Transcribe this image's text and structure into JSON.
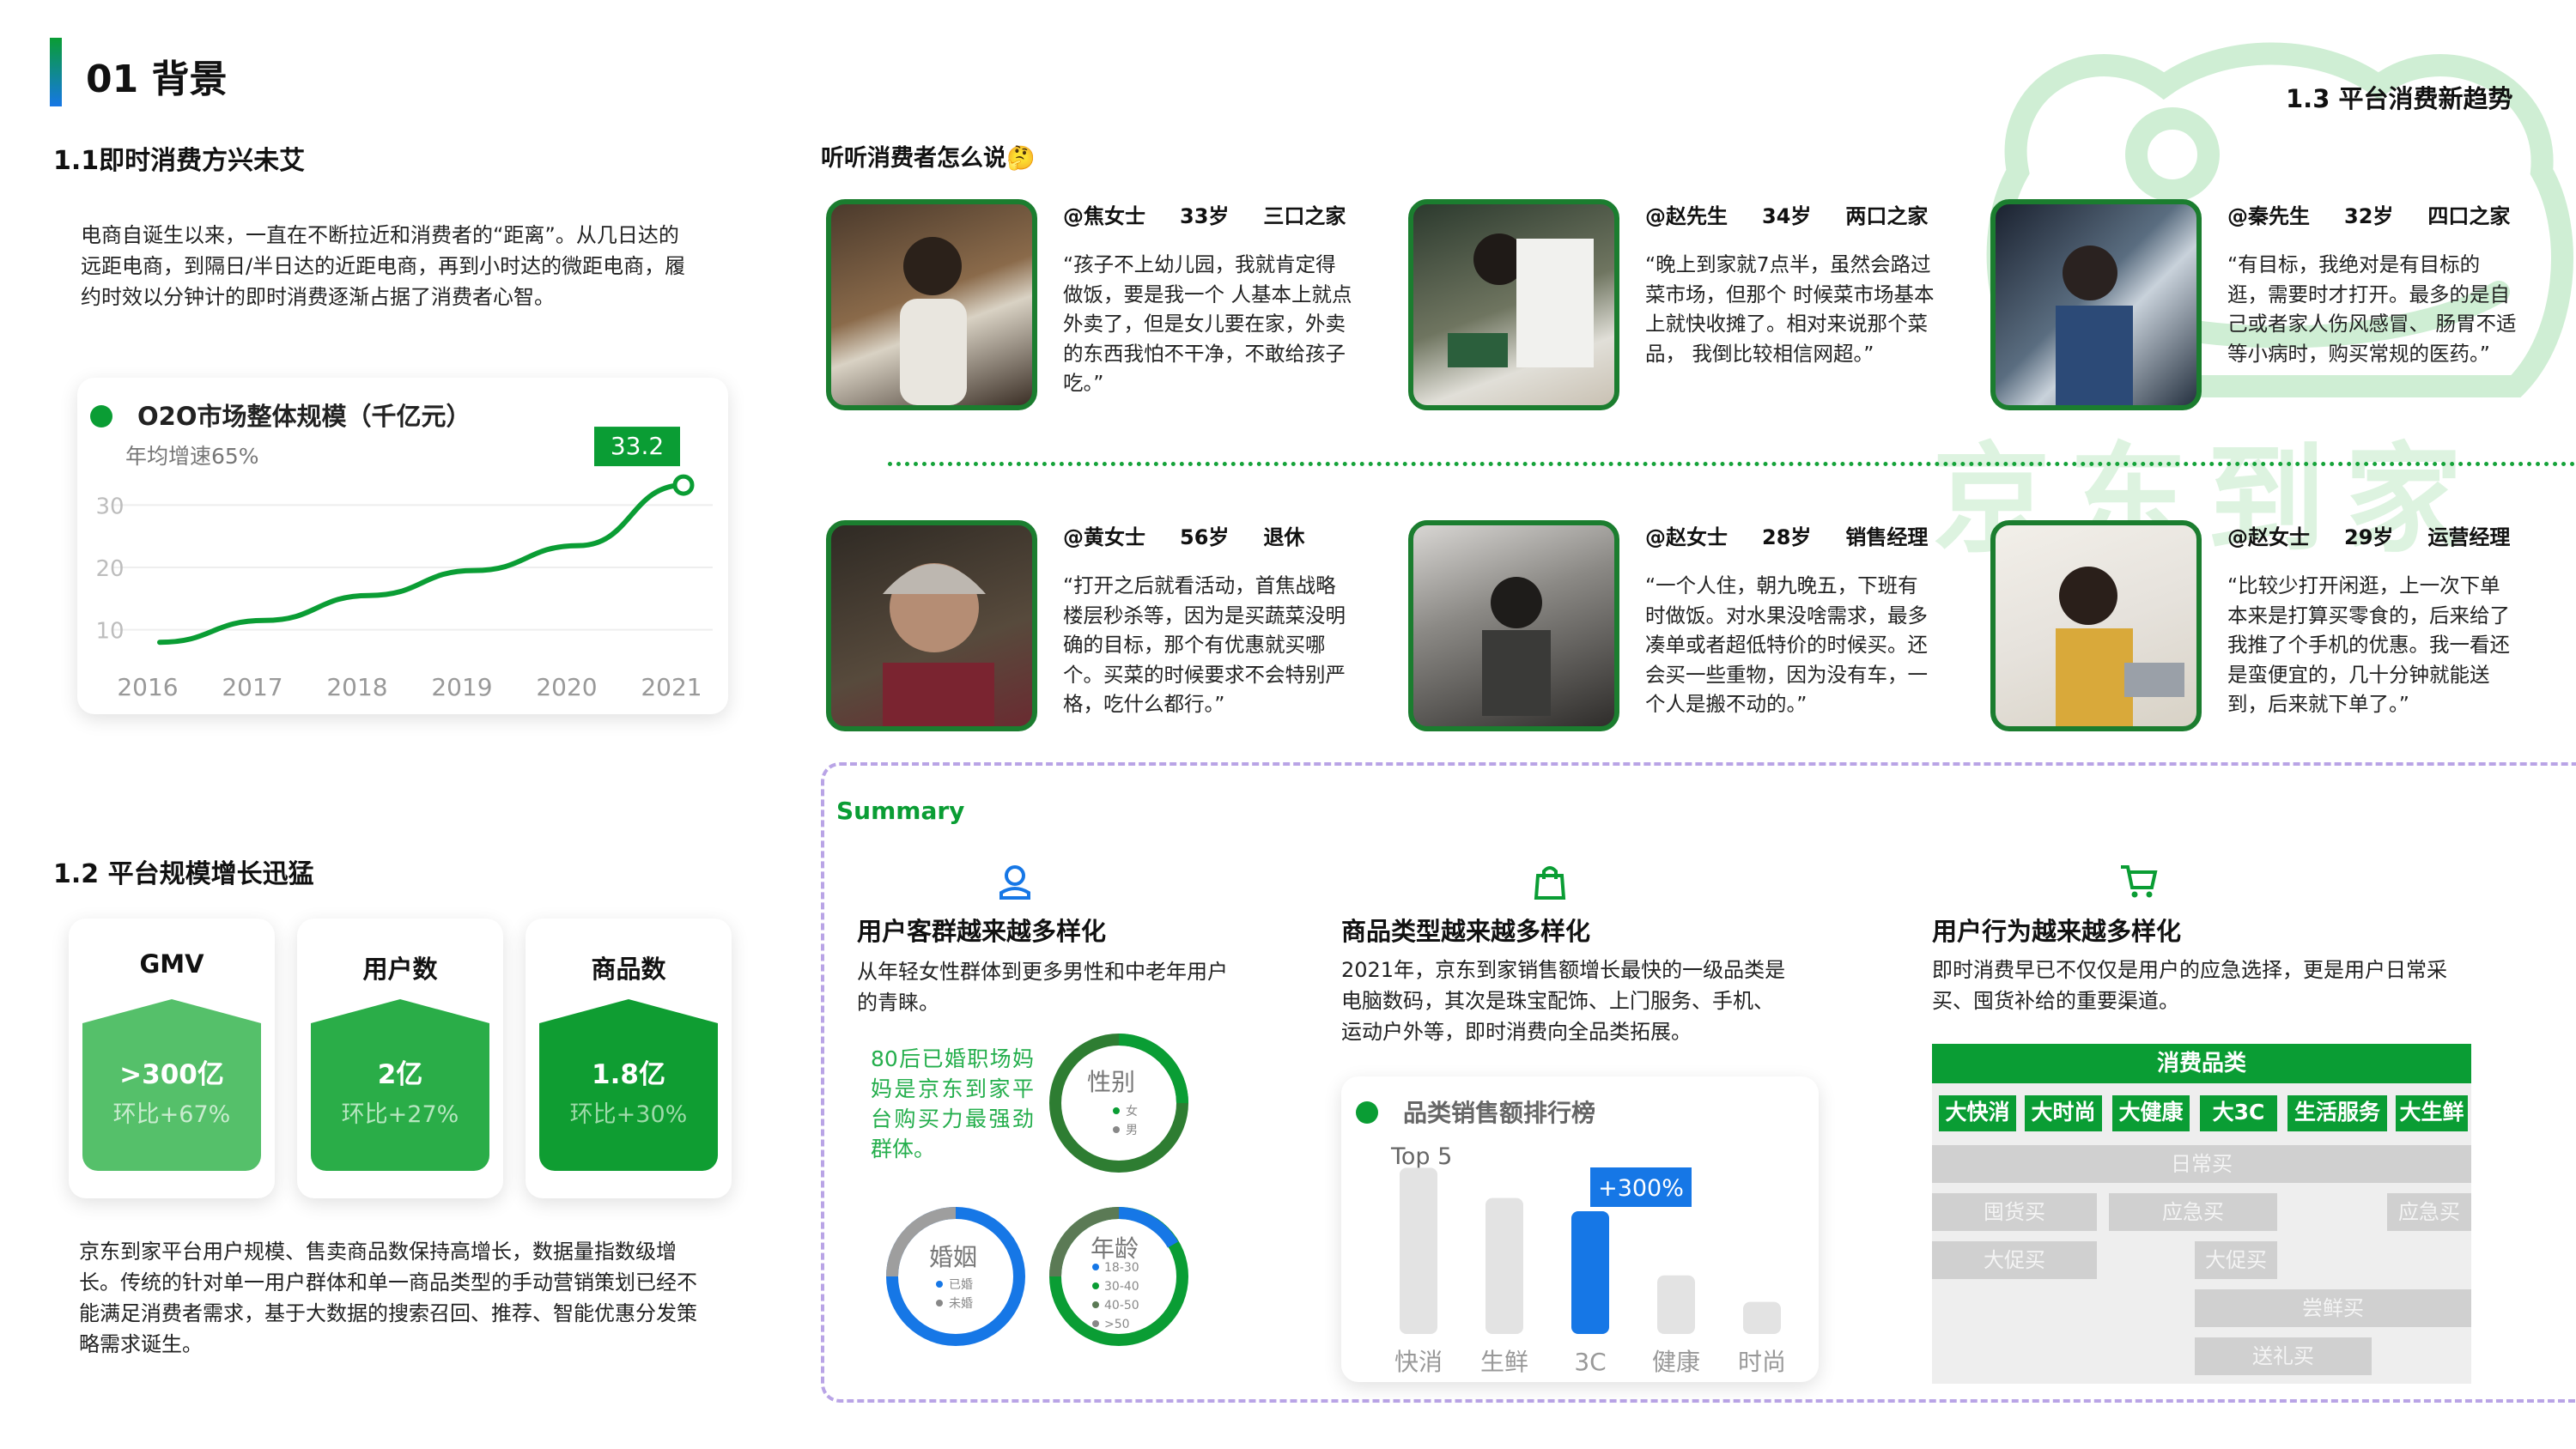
{
  "header": {
    "title": "01 背景",
    "right_title": "1.3 平台消费新趋势"
  },
  "watermark": {
    "text": "京东到家"
  },
  "sec11": {
    "title": "1.1即时消费方兴未艾",
    "para": "电商自诞生以来，一直在不断拉近和消费者的“距离”。从几日达的远距电商，到隔日/半日达的近距电商，再到小时达的微距电商，履约时效以分钟计的即时消费逐渐占据了消费者心智。"
  },
  "chart_card": {
    "title": "O2O市场整体规模（千亿元）",
    "subtitle": "年均增速65%",
    "callout": "33.2"
  },
  "chart_data": [
    {
      "type": "line",
      "title": "O2O市场整体规模（千亿元）",
      "subtitle": "年均增速65%",
      "x": [
        "2016",
        "2017",
        "2018",
        "2019",
        "2020",
        "2021"
      ],
      "yticks": [
        "10",
        "20",
        "30"
      ],
      "series": [
        {
          "values": [
            8.0,
            11.5,
            15.5,
            19.5,
            23.5,
            33.2
          ]
        }
      ],
      "ylim": [
        5,
        35
      ],
      "annotation": "33.2",
      "grid": true,
      "color": "#0a9d34"
    },
    {
      "type": "bar",
      "title": "品类销售额排行榜",
      "subtitle": "Top 5",
      "categories": [
        "快消",
        "生鲜",
        "3C",
        "健康",
        "时尚"
      ],
      "values": [
        0.88,
        0.72,
        0.65,
        0.31,
        0.17
      ],
      "highlight": "3C",
      "annotation": "+300%",
      "colors": {
        "default": "#e3e3e3",
        "highlight": "#1677e6"
      }
    }
  ],
  "sec12": {
    "title": "1.2 平台规模增长迅猛",
    "stats": [
      {
        "label": "GMV",
        "value": ">300亿",
        "sub": "环比+67%",
        "color": "#55c06a"
      },
      {
        "label": "用户数",
        "value": "2亿",
        "sub": "环比+27%",
        "color": "#2aad48"
      },
      {
        "label": "商品数",
        "value": "1.8亿",
        "sub": "环比+30%",
        "color": "#0f9d32"
      }
    ],
    "para": "京东到家平台用户规模、售卖商品数保持高增长，数据量指数级增长。传统的针对单一用户群体和单一商品类型的手动营销策划已经不能满足消费者需求，基于大数据的搜索召回、推荐、智能优惠分发策略需求诞生。"
  },
  "voices": {
    "title": "听听消费者怎么说🤔",
    "people": [
      {
        "name": "@焦女士",
        "age": "33岁",
        "tag": "三口之家",
        "quote": "“孩子不上幼儿园，我就肯定得做饭，要是我一个 人基本上就点外卖了，但是女儿要在家，外卖的东西我怕不干净，不敢给孩子吃。”"
      },
      {
        "name": "@赵先生",
        "age": "34岁",
        "tag": "两口之家",
        "quote": "“晚上到家就7点半，虽然会路过菜市场，但那个 时候菜市场基本上就快收摊了。相对来说那个菜品， 我倒比较相信网超。”"
      },
      {
        "name": "@秦先生",
        "age": "32岁",
        "tag": "四口之家",
        "quote": "“有目标，我绝对是有目标的逛，需要时才打开。最多的是自己或者家人伤风感冒、 肠胃不适等小病时，购买常规的医药。”"
      },
      {
        "name": "@黄女士",
        "age": "56岁",
        "tag": "退休",
        "quote": "“打开之后就看活动，首焦战略楼层秒杀等，因为是买蔬菜没明确的目标，那个有优惠就买哪个。买菜的时候要求不会特别严格，吃什么都行。”"
      },
      {
        "name": "@赵女士",
        "age": "28岁",
        "tag": "销售经理",
        "quote": "“一个人住，朝九晚五，下班有时做饭。对水果没啥需求，最多凑单或者超低特价的时候买。还会买一些重物，因为没有车，一个人是搬不动的。”"
      },
      {
        "name": "@赵女士",
        "age": "29岁",
        "tag": "运营经理",
        "quote": "“比较少打开闲逛，上一次下单本来是打算买零食的，后来给了我推了个手机的优惠。我一看还是蛮便宜的，几十分钟就能送到，后来就下单了。”"
      }
    ]
  },
  "summary": {
    "label": "Summary",
    "cols": [
      {
        "icon": "user-icon",
        "title": "用户客群越来越多样化",
        "text": "从年轻女性群体到更多男性和中老年用户的青睐。"
      },
      {
        "icon": "bag-icon",
        "title": "商品类型越来越多样化",
        "text": "2021年，京东到家销售额增长最快的一级品类是电脑数码，其次是珠宝配饰、上门服务、手机、运动户外等，即时消费向全品类拓展。"
      },
      {
        "icon": "cart-icon",
        "title": "用户行为越来越多样化",
        "text": "即时消费早已不仅仅是用户的应急选择，更是用户日常采买、囤货补给的重要渠道。"
      }
    ],
    "green_note": "80后已婚职场妈妈是京东到家平台购买力最强劲群体。",
    "donuts": [
      {
        "title": "性别",
        "legend": [
          "女",
          "男"
        ]
      },
      {
        "title": "婚姻",
        "legend": [
          "已婚",
          "未婚"
        ]
      },
      {
        "title": "年龄",
        "legend": [
          "18-30",
          "30-40",
          "40-50",
          ">50"
        ]
      }
    ],
    "bar_card": {
      "title": "品类销售额排行榜",
      "subtitle": "Top 5",
      "badge": "+300%"
    },
    "table": {
      "header": "消费品类",
      "cats": [
        "大快消",
        "大时尚",
        "大健康",
        "大3C",
        "生活服务",
        "大生鲜"
      ],
      "rows": [
        "日常买",
        "囤货买",
        "应急买",
        "应急买",
        "大促买",
        "大促买",
        "尝鲜买",
        "送礼买"
      ]
    }
  }
}
